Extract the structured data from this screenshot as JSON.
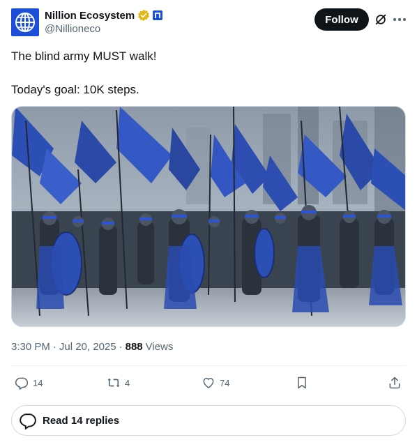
{
  "author": {
    "display_name": "Nillion Ecosystem",
    "handle": "@Nillioneco",
    "verified": true,
    "affiliate_badge": "n-logo",
    "avatar_icon": "globe-grid-icon"
  },
  "header": {
    "follow_label": "Follow",
    "grok_icon": "grok-icon",
    "more_icon": "more-horizontal-icon"
  },
  "tweet": {
    "lines": [
      "The blind army MUST walk!",
      "",
      "Today's goal: 10K steps."
    ],
    "media_description": "",
    "time": "3:30 PM",
    "date": "Jul 20, 2025",
    "views_count": "888",
    "views_label": "Views"
  },
  "actions": {
    "replies": "14",
    "reposts": "4",
    "likes": "74",
    "bookmark_icon": "bookmark-icon",
    "share_icon": "share-icon"
  },
  "read_replies_label": "Read 14 replies",
  "colors": {
    "accent": "#1d4fd8",
    "text": "#0f1419",
    "muted": "#536471",
    "gold_badge": "#e2b719"
  }
}
